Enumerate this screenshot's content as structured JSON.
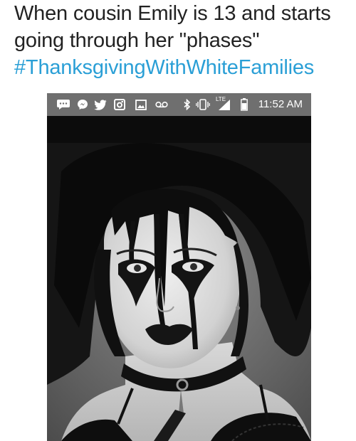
{
  "tweet": {
    "line1": "When cousin Emily is 13 and starts",
    "line2": "going through her \"phases\"",
    "hashtag": "#ThanksgivingWithWhiteFamilies"
  },
  "statusbar": {
    "time": "11:52 AM",
    "network": "LTE",
    "icons": [
      "message-icon",
      "messenger-icon",
      "twitter-icon",
      "instagram-icon",
      "gallery-icon",
      "voicemail-icon",
      "bluetooth-icon",
      "vibrate-icon",
      "signal-icon",
      "battery-icon"
    ]
  },
  "colors": {
    "text": "#222222",
    "hashtag": "#2a9fd6",
    "statusbar": "#6f6f6f"
  }
}
